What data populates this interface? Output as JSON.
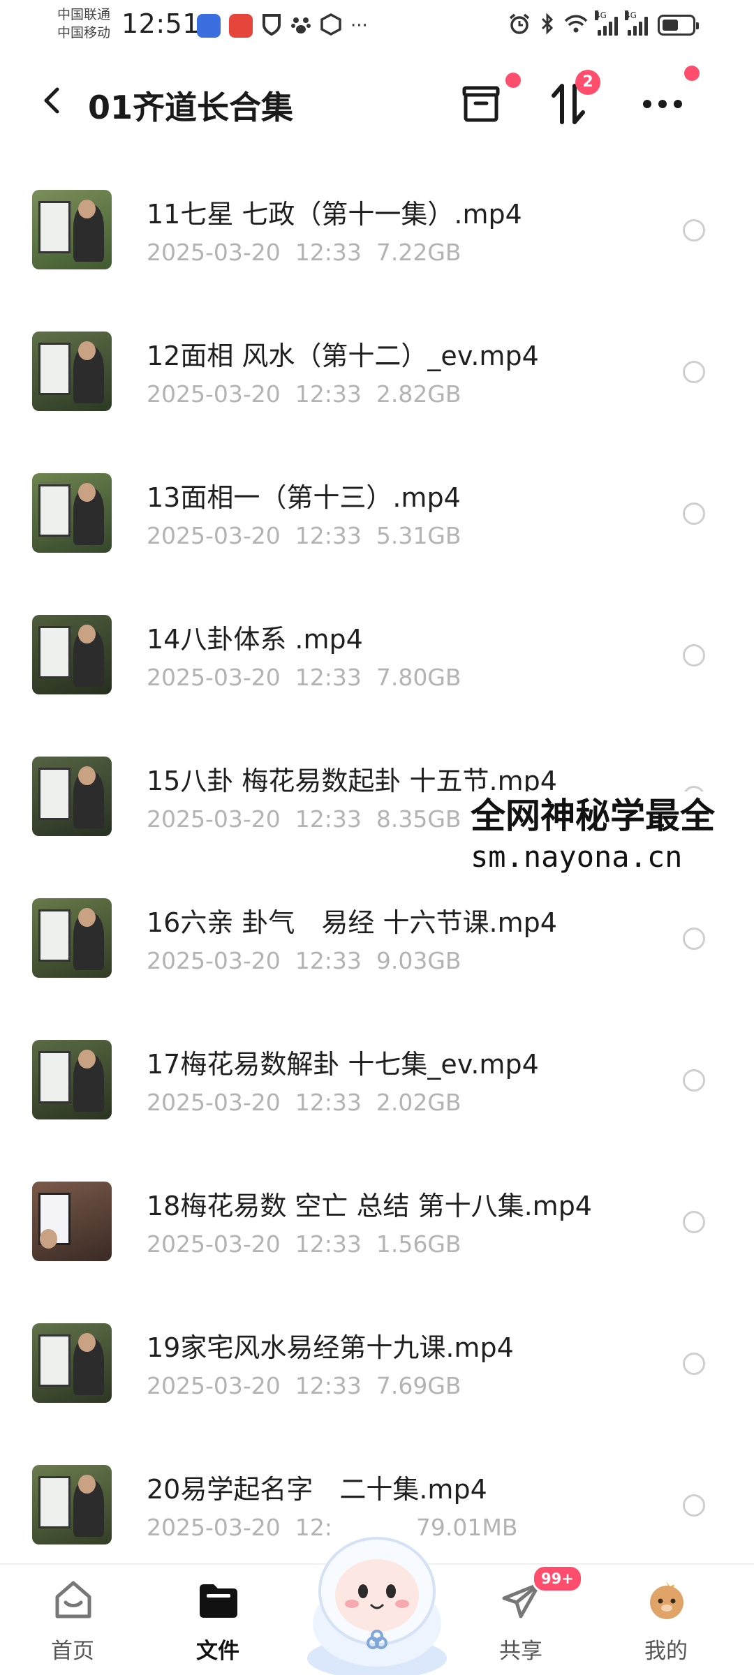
{
  "status_bar": {
    "carrier_1": "中国联通",
    "carrier_2": "中国移动",
    "time": "12:51",
    "more": "···",
    "network_1": "4G",
    "network_2": "4G",
    "battery_level": 0.55
  },
  "header": {
    "title": "01齐道长合集",
    "sort_badge": "2"
  },
  "files": [
    {
      "name": "11七星 七政（第十一集）.mp4",
      "date": "2025-03-20",
      "time": "12:33",
      "size": "7.22GB"
    },
    {
      "name": "12面相 风水（第十二）_ev.mp4",
      "date": "2025-03-20",
      "time": "12:33",
      "size": "2.82GB"
    },
    {
      "name": "13面相一（第十三）.mp4",
      "date": "2025-03-20",
      "time": "12:33",
      "size": "5.31GB"
    },
    {
      "name": "14八卦体系 .mp4",
      "date": "2025-03-20",
      "time": "12:33",
      "size": "7.80GB"
    },
    {
      "name": "15八卦 梅花易数起卦 十五节.mp4",
      "date": "2025-03-20",
      "time": "12:33",
      "size": "8.35GB"
    },
    {
      "name": "16六亲 卦气　易经  十六节课.mp4",
      "date": "2025-03-20",
      "time": "12:33",
      "size": "9.03GB"
    },
    {
      "name": "17梅花易数解卦 十七集_ev.mp4",
      "date": "2025-03-20",
      "time": "12:33",
      "size": "2.02GB"
    },
    {
      "name": "18梅花易数 空亡 总结  第十八集.mp4",
      "date": "2025-03-20",
      "time": "12:33",
      "size": "1.56GB"
    },
    {
      "name": "19家宅风水易经第十九课.mp4",
      "date": "2025-03-20",
      "time": "12:33",
      "size": "7.69GB"
    },
    {
      "name": "20易学起名字　二十集.mp4",
      "date": "2025-03-20",
      "time": "12:",
      "size": "79.01MB"
    }
  ],
  "watermark": {
    "line1": "全网神秘学最全",
    "line2": "sm.nayona.cn"
  },
  "bottom_nav": {
    "home": "首页",
    "files": "文件",
    "share": "共享",
    "share_badge": "99+",
    "mine": "我的"
  },
  "colors": {
    "accent": "#ff4d6d",
    "text_primary": "#1f1f1f",
    "text_meta": "#b3b3b3",
    "radio_border": "#cfcfcf"
  }
}
